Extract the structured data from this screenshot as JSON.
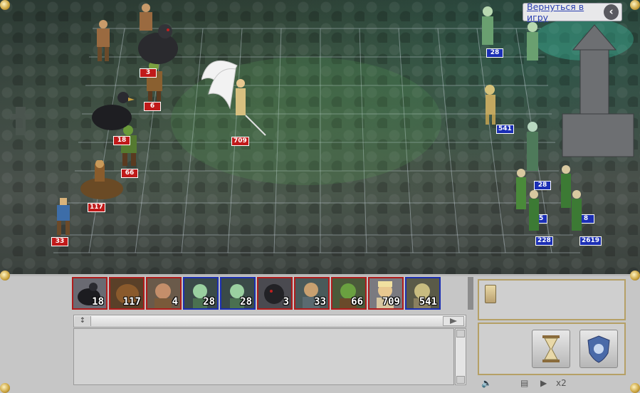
{
  "header": {
    "back_label": "Вернуться в игру",
    "back_icon": "chevron-left-icon"
  },
  "attackers": [
    {
      "name": "centaur",
      "count": "33",
      "color": "#c01a1a"
    },
    {
      "name": "boar-rider",
      "count": "117",
      "color": "#c01a1a"
    },
    {
      "name": "orc",
      "count": "66",
      "color": "#c01a1a"
    },
    {
      "name": "thunderbird",
      "count": "18",
      "color": "#c01a1a"
    },
    {
      "name": "orc-shaman",
      "count": "6",
      "color": "#c01a1a"
    },
    {
      "name": "black-beast",
      "count": "3",
      "color": "#c01a1a"
    },
    {
      "name": "angel",
      "count": "709",
      "color": "#c01a1a"
    }
  ],
  "defenders": [
    {
      "name": "dryad",
      "count": "28",
      "color": "#1b2fb5"
    },
    {
      "name": "skeleton",
      "count": "541",
      "color": "#1b2fb5"
    },
    {
      "name": "wood-elf",
      "count": "28",
      "color": "#1b2fb5"
    },
    {
      "name": "elf-archer",
      "count": "55",
      "color": "#1b2fb5"
    },
    {
      "name": "archer-group",
      "count": "228",
      "color": "#1b2fb5"
    },
    {
      "name": "elf-hunter",
      "count": "2619",
      "color": "#1b2fb5"
    },
    {
      "name": "elf-archer-2",
      "count": "8",
      "color": "#1b2fb5"
    }
  ],
  "queue": [
    {
      "unit": "thunderbird",
      "count": "18",
      "side": "red"
    },
    {
      "unit": "boar-rider",
      "count": "117",
      "side": "red"
    },
    {
      "unit": "ogre",
      "count": "4",
      "side": "red"
    },
    {
      "unit": "dryad",
      "count": "28",
      "side": "blue"
    },
    {
      "unit": "dryad",
      "count": "28",
      "side": "blue"
    },
    {
      "unit": "black-beast",
      "count": "3",
      "side": "red"
    },
    {
      "unit": "centaur",
      "count": "33",
      "side": "red"
    },
    {
      "unit": "orc",
      "count": "66",
      "side": "red"
    },
    {
      "unit": "angel",
      "count": "709",
      "side": "red"
    },
    {
      "unit": "skeleton",
      "count": "541",
      "side": "blue"
    }
  ],
  "controls": {
    "speed_label": "x2",
    "wait_icon": "hourglass-icon",
    "defend_icon": "shield-icon",
    "sound_icon": "speaker-icon",
    "book_icon": "spellbook-icon",
    "play_icon": "play-icon"
  }
}
